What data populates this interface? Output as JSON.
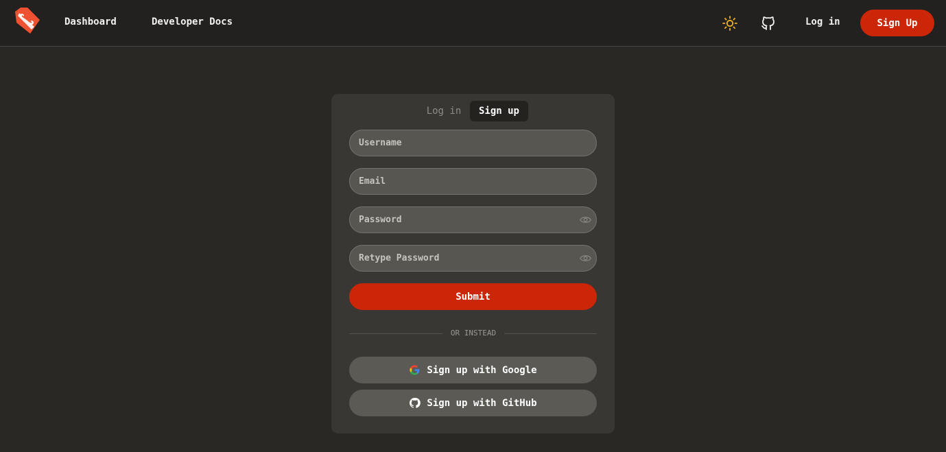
{
  "header": {
    "logo": "git-logo-icon",
    "nav": [
      {
        "label": "Dashboard"
      },
      {
        "label": "Developer Docs"
      }
    ],
    "icons": [
      "sun-icon",
      "github-icon"
    ],
    "login_label": "Log in",
    "signup_label": "Sign Up",
    "accent_color": "#cc2608"
  },
  "auth_card": {
    "tabs": [
      {
        "label": "Log in",
        "active": false
      },
      {
        "label": "Sign up",
        "active": true
      }
    ],
    "fields": {
      "username": {
        "placeholder": "Username",
        "value": ""
      },
      "email": {
        "placeholder": "Email",
        "value": ""
      },
      "password": {
        "placeholder": "Password",
        "value": ""
      },
      "retype_password": {
        "placeholder": "Retype Password",
        "value": ""
      }
    },
    "submit_label": "Submit",
    "divider_label": "OR INSTEAD",
    "google_label": "Sign up with Google",
    "github_label": "Sign up with GitHub"
  }
}
